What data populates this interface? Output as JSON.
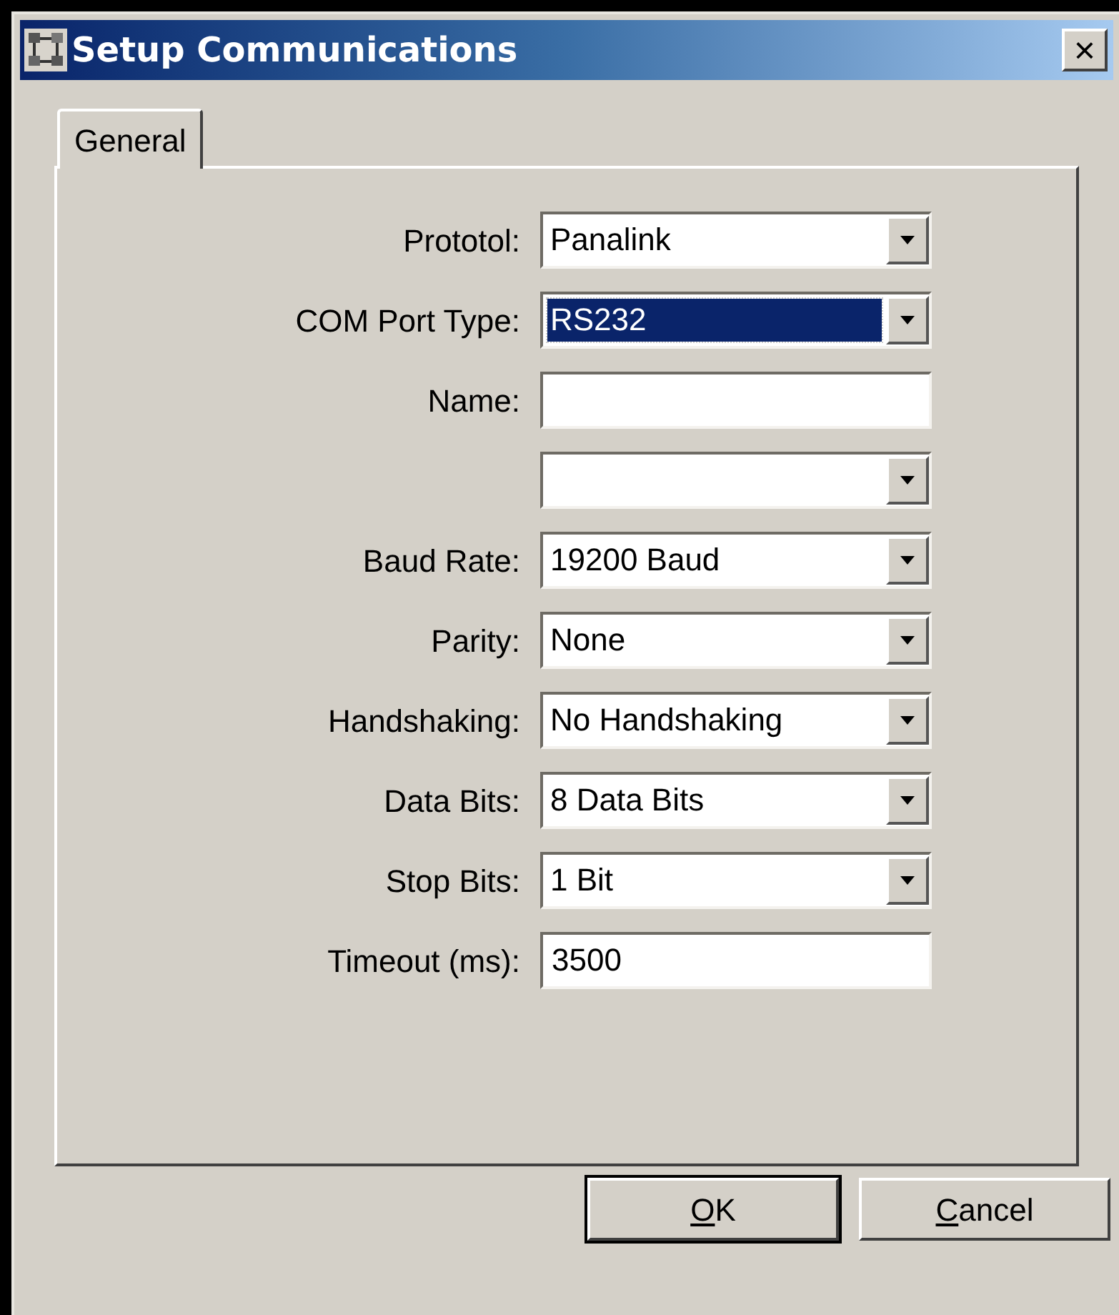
{
  "window": {
    "title": "Setup Communications",
    "close": "×"
  },
  "tabs": [
    {
      "label": "General",
      "selected": true
    }
  ],
  "fields": [
    {
      "kind": "dropdown",
      "label": "Prototol:",
      "value": "Panalink",
      "selected": false
    },
    {
      "kind": "dropdown",
      "label": "COM Port Type:",
      "value": "RS232",
      "selected": true
    },
    {
      "kind": "text",
      "label": "Name:"
    },
    {
      "kind": "dropdown",
      "selected": false
    },
    {
      "kind": "dropdown",
      "label": "Baud Rate:",
      "value": "19200 Baud",
      "selected": false
    },
    {
      "kind": "dropdown",
      "label": "Parity:",
      "value": "None",
      "selected": false
    },
    {
      "kind": "dropdown",
      "label": "Handshaking:",
      "value": "No Handshaking",
      "selected": false
    },
    {
      "kind": "dropdown",
      "label": "Data Bits:",
      "value": "8 Data Bits",
      "selected": false
    },
    {
      "kind": "dropdown",
      "label": "Stop Bits:",
      "value": "1 Bit",
      "selected": false
    },
    {
      "kind": "text",
      "label": "Timeout (ms):",
      "value": "3500"
    }
  ],
  "buttons": [
    {
      "label": "OK",
      "default": true
    },
    {
      "label": "Cancel",
      "default": false
    }
  ]
}
